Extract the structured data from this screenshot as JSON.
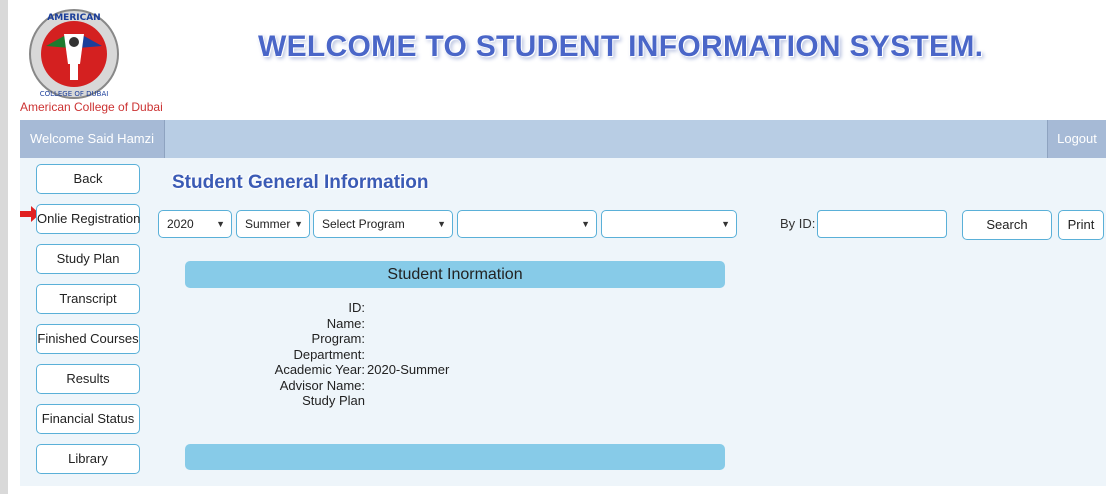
{
  "header": {
    "logo_caption": "American College of Dubai",
    "logo_text_top": "AMERICAN",
    "logo_text_bottom": "COLLEGE OF DUBAI",
    "title": "WELCOME TO STUDENT INFORMATION SYSTEM."
  },
  "topbar": {
    "welcome": "Welcome Said Hamzi",
    "logout": "Logout"
  },
  "sidebar": {
    "items": [
      {
        "label": "Back"
      },
      {
        "label": "Onlie Registration"
      },
      {
        "label": "Study Plan"
      },
      {
        "label": "Transcript"
      },
      {
        "label": "Finished Courses"
      },
      {
        "label": "Results"
      },
      {
        "label": "Financial Status"
      },
      {
        "label": "Library"
      }
    ]
  },
  "main": {
    "section_title": "Student General Information",
    "filters": {
      "year": "2020",
      "term": "Summer",
      "program": "Select Program",
      "select4": "",
      "select5": ""
    },
    "byid_label": "By ID:",
    "byid_value": "",
    "search_label": "Search",
    "print_label": "Print",
    "info_header": "Student Inormation",
    "info": [
      {
        "label": "ID:",
        "value": ""
      },
      {
        "label": "Name:",
        "value": ""
      },
      {
        "label": "Program:",
        "value": ""
      },
      {
        "label": "Department:",
        "value": ""
      },
      {
        "label": "Academic Year:",
        "value": "2020-Summer"
      },
      {
        "label": "Advisor Name:",
        "value": ""
      },
      {
        "label": "Study Plan",
        "value": ""
      }
    ]
  },
  "colors": {
    "accent_border": "#5ab0d8",
    "header_bar": "#87cbe8",
    "topbar": "#b8cde4",
    "title_blue": "#4a66c8",
    "arrow_red": "#e02020"
  }
}
